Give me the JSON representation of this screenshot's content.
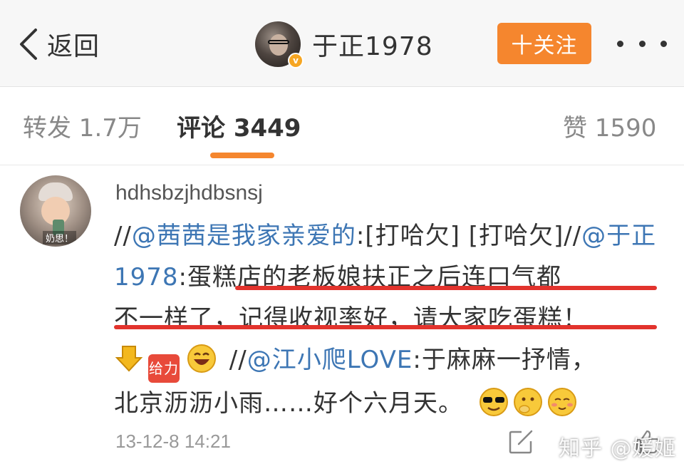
{
  "header": {
    "back_label": "返回",
    "username": "于正1978",
    "verified_badge": "v",
    "follow_label": "十关注",
    "accent_color": "#f5862e"
  },
  "tabs": [
    {
      "label": "转发 1.7万",
      "active": false
    },
    {
      "label": "评论 3449",
      "active": true
    },
    {
      "label": "赞 1590",
      "active": false
    }
  ],
  "comment": {
    "username": "hdhsbzjhdbsnsj",
    "avatar_tag": "奶思！",
    "text_prefix": "//",
    "mention1": "@茜茜是我家亲爱的",
    "segment1": ":[打哈欠] [打哈欠]//",
    "mention2": "@于正1978",
    "colon": ":",
    "highlight_line1": "蛋糕店的老板娘扶正之后连口气都",
    "highlight_line2": "不一样了，记得收视率好，请大家吃蛋糕！",
    "emoji_box_label": "给力",
    "segment2": " //",
    "mention3": "@江小爬LOVE",
    "segment3": ":于麻麻一抒情，",
    "line_last": "北京沥沥小雨……好个六月天。",
    "timestamp": "13-12-8 14:21",
    "underline_color": "#e2332d",
    "mention_color": "#3d76b4"
  },
  "watermark": "知乎 @媛姬",
  "icons": [
    "chevron-left-icon",
    "more-dots-icon",
    "share-edit-icon",
    "like-icon"
  ]
}
